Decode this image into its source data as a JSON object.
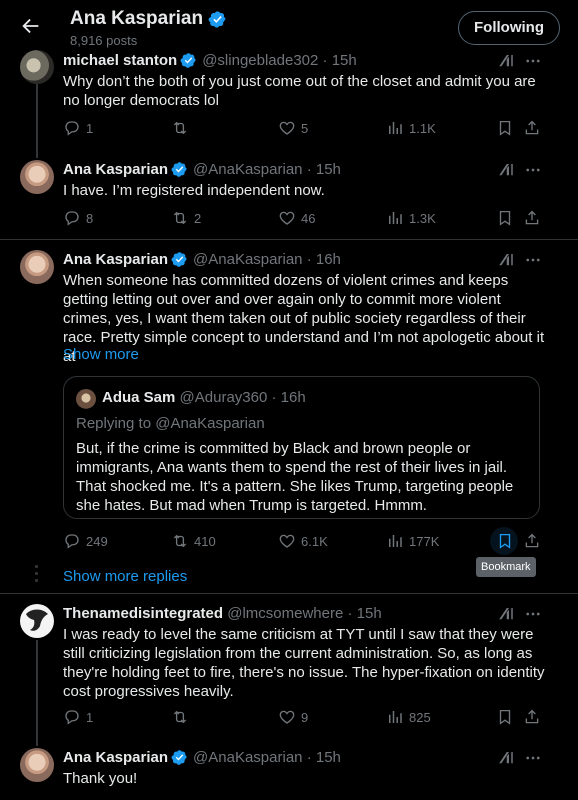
{
  "header": {
    "name": "Ana Kasparian",
    "posts_count": "8,916 posts",
    "follow_label": "Following"
  },
  "posts": [
    {
      "name": "michael stanton",
      "handle": "@slingeblade302",
      "time": "· 15h",
      "text": "Why don’t the both of you just come out of the closet and admit you are no longer democrats lol",
      "replies": "1",
      "reposts": "",
      "likes": "5",
      "views": "1.1K"
    },
    {
      "name": "Ana Kasparian",
      "handle": "@AnaKasparian",
      "time": "· 15h",
      "text": "I have. I’m registered independent now.",
      "replies": "8",
      "reposts": "2",
      "likes": "46",
      "views": "1.3K"
    },
    {
      "name": "Ana Kasparian",
      "handle": "@AnaKasparian",
      "time": "· 16h",
      "text": "When someone has committed dozens of violent crimes and keeps getting letting out over and over again only to commit more violent crimes, yes, I want them taken out of public society regardless of their race. Pretty simple concept to understand and I’m not apologetic about it at",
      "show_more": "Show more",
      "replies": "249",
      "reposts": "410",
      "likes": "6.1K",
      "views": "177K",
      "quote": {
        "name": "Adua Sam",
        "handle": "@Aduray360",
        "time": "· 16h",
        "replying_to": "Replying to @AnaKasparian",
        "text": "But, if the crime is committed by Black and brown people or immigrants, Ana wants them to spend the  rest of their lives in jail. That shocked me. It's a pattern. She likes Trump, targeting people she hates. But mad when Trump is targeted. Hmmm."
      }
    },
    {
      "name": "Thenamedisintegrated",
      "handle": "@lmcsomewhere",
      "time": "· 15h",
      "text": "I was ready to level the same criticism at TYT until I saw that they were still criticizing legislation from the current administration. So, as long as they're holding feet to fire, there's no issue. The hyper-fixation on identity cost progressives heavily.",
      "replies": "1",
      "reposts": "",
      "likes": "9",
      "views": "825"
    },
    {
      "name": "Ana Kasparian",
      "handle": "@AnaKasparian",
      "time": "· 15h",
      "text": "Thank you!"
    }
  ],
  "show_more_replies": "Show more replies",
  "tooltip": "Bookmark",
  "colors": {
    "background": "#000000",
    "text": "#e7e9ea",
    "secondary": "#71767b",
    "accent": "#1d9bf0",
    "border": "#2f3336"
  }
}
